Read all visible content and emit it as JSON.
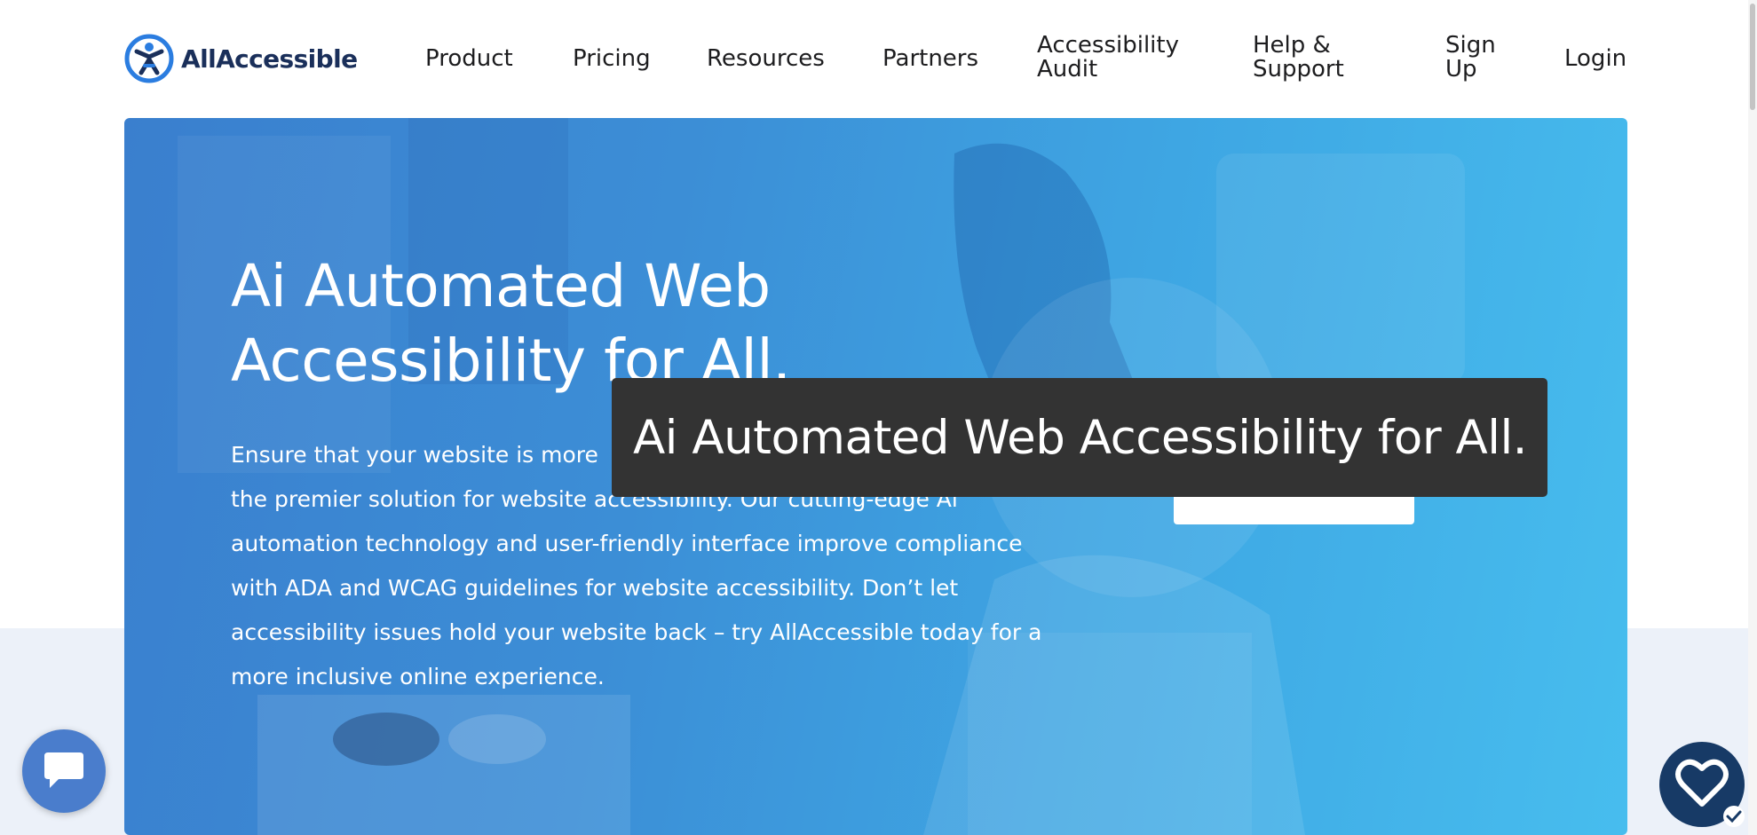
{
  "brand": {
    "name_prefix": "All",
    "name_suffix": "Accessible",
    "primary_color": "#1a2f5a",
    "accent_color": "#2b7de0",
    "logo_icon": "accessibility-person-icon"
  },
  "nav": {
    "items": [
      {
        "label": "Product"
      },
      {
        "label": "Pricing"
      },
      {
        "label": "Resources"
      },
      {
        "label": "Partners"
      },
      {
        "label_line1": "Accessibility",
        "label_line2": "Audit"
      },
      {
        "label_line1": "Help &",
        "label_line2": "Support"
      },
      {
        "label_line1": "Sign",
        "label_line2": "Up"
      },
      {
        "label": "Login"
      }
    ]
  },
  "hero": {
    "title_line1": "Ai Automated Web",
    "title_line2": "Accessibility for All.",
    "body": "Ensure that your website is more accessible with AllAccessible, the premier solution for website accessibility. Our cutting-edge Ai automation technology and user-friendly interface improve compliance with ADA and WCAG guidelines for website accessibility. Don’t let accessibility issues hold your website back – try AllAccessible today for a more inclusive online experience.",
    "body_lines": [
      "Ensure that your website is more",
      "the premier solution for website accessibility. Our cutting-edge Ai",
      "automation technology and user-friendly interface improve compliance",
      "with ADA and WCAG guidelines for website accessibility. Don’t let",
      "accessibility issues hold your website back – try AllAccessible today for a",
      "more inclusive online experience."
    ],
    "gradient_start": "#3a7fce",
    "gradient_end": "#47bdee"
  },
  "tooltip": {
    "text": "Ai Automated Web Accessibility for All.",
    "background": "#333333"
  },
  "widgets": {
    "chat_icon": "chat-bubble-icon",
    "accessibility_icon": "heart-check-icon"
  }
}
